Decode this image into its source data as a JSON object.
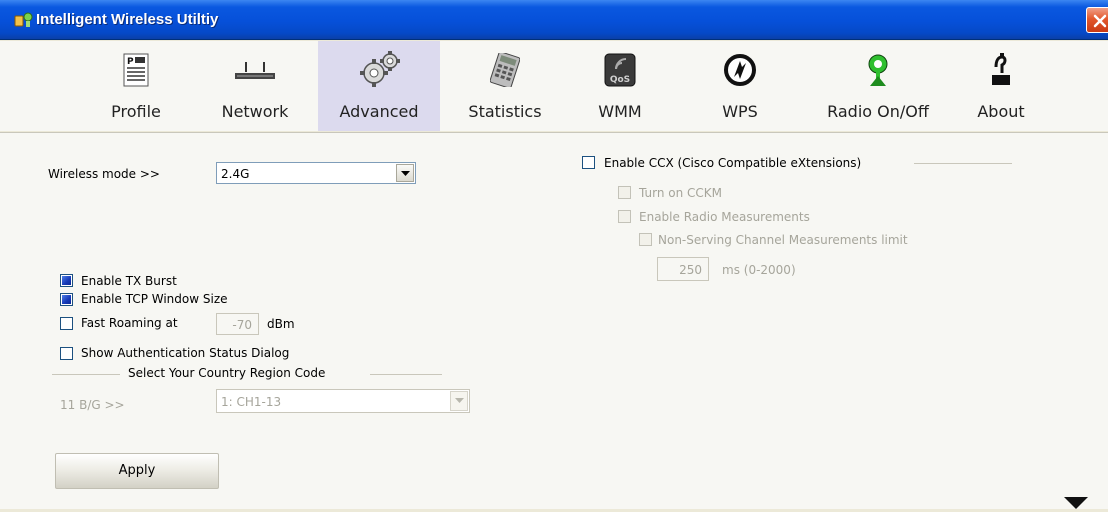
{
  "window": {
    "title": "Intelligent Wireless Utiltiy"
  },
  "toolbar": {
    "items": [
      {
        "label": "Profile",
        "icon": "profile-icon"
      },
      {
        "label": "Network",
        "icon": "network-icon"
      },
      {
        "label": "Advanced",
        "icon": "gears-icon",
        "active": true
      },
      {
        "label": "Statistics",
        "icon": "calculator-icon"
      },
      {
        "label": "WMM",
        "icon": "qos-icon"
      },
      {
        "label": "WPS",
        "icon": "wps-icon"
      },
      {
        "label": "Radio On/Off",
        "icon": "antenna-icon"
      },
      {
        "label": "About",
        "icon": "about-icon"
      }
    ],
    "wmm_badge_text": "QoS"
  },
  "advanced": {
    "wireless_mode_label": "Wireless mode >>",
    "wireless_mode_value": "2.4G",
    "tx_burst_label": "Enable TX Burst",
    "tx_burst_checked": true,
    "tcp_window_label": "Enable TCP Window Size",
    "tcp_window_checked": true,
    "fast_roaming_label": "Fast Roaming at",
    "fast_roaming_checked": false,
    "fast_roaming_value": "-70",
    "fast_roaming_unit": "dBm",
    "auth_status_label": "Show Authentication Status Dialog",
    "auth_status_checked": false,
    "country_group_title": "Select Your Country Region Code",
    "band_label": "11 B/G >>",
    "country_value": "1: CH1-13",
    "apply_label": "Apply"
  },
  "ccx": {
    "enable_label": "Enable CCX (Cisco Compatible eXtensions)",
    "enable_checked": false,
    "cckm_label": "Turn on CCKM",
    "radio_measurements_label": "Enable Radio Measurements",
    "non_serving_label": "Non-Serving Channel Measurements limit",
    "limit_value": "250",
    "limit_unit": "ms (0-2000)"
  },
  "colors": {
    "titlebar": "#0650d9",
    "active_tab": "#dcdaee",
    "checked_fill": "#1538b6",
    "close_button": "#e2582d"
  }
}
